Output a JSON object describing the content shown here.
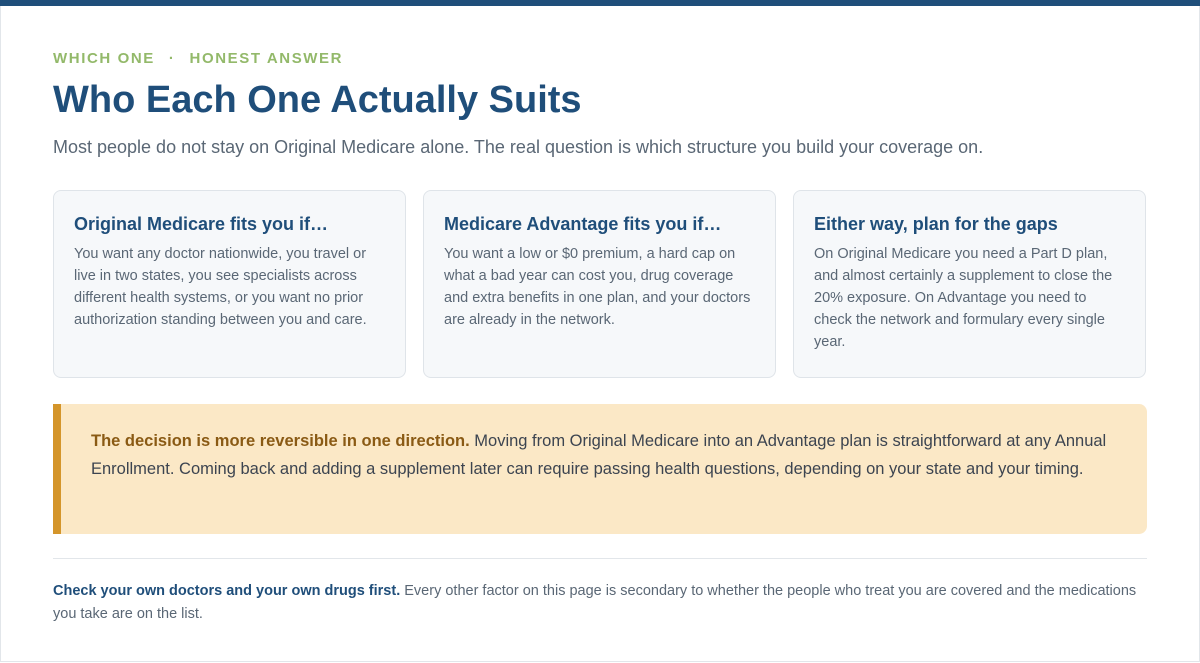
{
  "colors": {
    "accent": "#1f4e7a",
    "eyebrow": "#93b96a",
    "callout_background": "#fbe8c6",
    "callout_border": "#d4952a",
    "callout_strong": "#8a5a14",
    "card_background": "#f6f8fa"
  },
  "header": {
    "eyebrow_left": "WHICH ONE",
    "eyebrow_separator": "·",
    "eyebrow_right": "HONEST ANSWER",
    "title": "Who Each One Actually Suits",
    "subtitle": "Most people do not stay on Original Medicare alone. The real question is which structure you build your coverage on."
  },
  "cards": [
    {
      "title": "Original Medicare fits you if…",
      "body": "You want any doctor nationwide, you travel or live in two states, you see specialists across different health systems, or you want no prior authorization standing between you and care."
    },
    {
      "title": "Medicare Advantage fits you if…",
      "body": "You want a low or $0 premium, a hard cap on what a bad year can cost you, drug coverage and extra benefits in one plan, and your doctors are already in the network."
    },
    {
      "title": "Either way, plan for the gaps",
      "body": "On Original Medicare you need a Part D plan, and almost certainly a supplement to close the 20% exposure. On Advantage you need to check the network and formulary every single year."
    }
  ],
  "callout": {
    "strong": "The decision is more reversible in one direction.",
    "text": " Moving from Original Medicare into an Advantage plan is straightforward at any Annual Enrollment. Coming back and adding a supplement later can require passing health questions, depending on your state and your timing."
  },
  "footnote": {
    "strong": "Check your own doctors and your own drugs first.",
    "text": " Every other factor on this page is secondary to whether the people who treat you are covered and the medications you take are on the list."
  }
}
